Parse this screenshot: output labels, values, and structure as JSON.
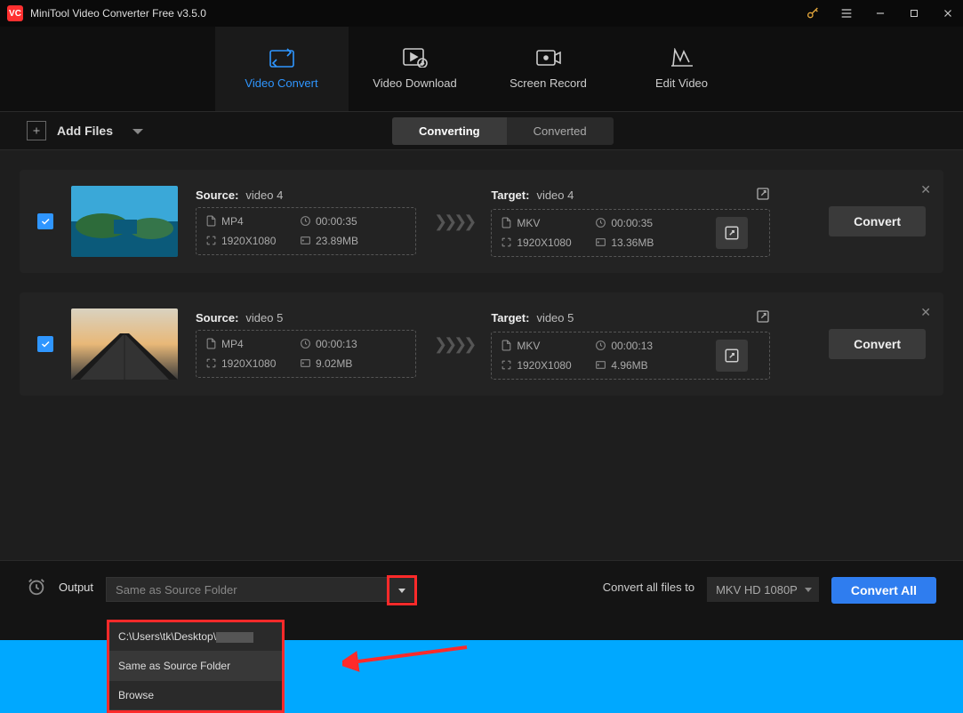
{
  "app": {
    "title": "MiniTool Video Converter Free v3.5.0",
    "logo_text": "VC"
  },
  "nav": [
    {
      "label": "Video Convert",
      "active": true
    },
    {
      "label": "Video Download",
      "active": false
    },
    {
      "label": "Screen Record",
      "active": false
    },
    {
      "label": "Edit Video",
      "active": false
    }
  ],
  "toolbar": {
    "add_files": "Add Files",
    "tab_converting": "Converting",
    "tab_converted": "Converted"
  },
  "items": [
    {
      "checked": true,
      "source": {
        "label": "Source:",
        "name": "video 4",
        "format": "MP4",
        "duration": "00:00:35",
        "resolution": "1920X1080",
        "size": "23.89MB"
      },
      "target": {
        "label": "Target:",
        "name": "video 4",
        "format": "MKV",
        "duration": "00:00:35",
        "resolution": "1920X1080",
        "size": "13.36MB"
      },
      "button": "Convert",
      "thumb_type": "coast"
    },
    {
      "checked": true,
      "source": {
        "label": "Source:",
        "name": "video 5",
        "format": "MP4",
        "duration": "00:00:13",
        "resolution": "1920X1080",
        "size": "9.02MB"
      },
      "target": {
        "label": "Target:",
        "name": "video 5",
        "format": "MKV",
        "duration": "00:00:13",
        "resolution": "1920X1080",
        "size": "4.96MB"
      },
      "button": "Convert",
      "thumb_type": "sunset"
    }
  ],
  "footer": {
    "output_label": "Output",
    "output_value": "Same as Source Folder",
    "dropdown": [
      "C:\\Users\\tk\\Desktop\\",
      "Same as Source Folder",
      "Browse"
    ],
    "convert_all_label": "Convert all files to",
    "format_value": "MKV HD 1080P",
    "convert_all_button": "Convert All"
  }
}
